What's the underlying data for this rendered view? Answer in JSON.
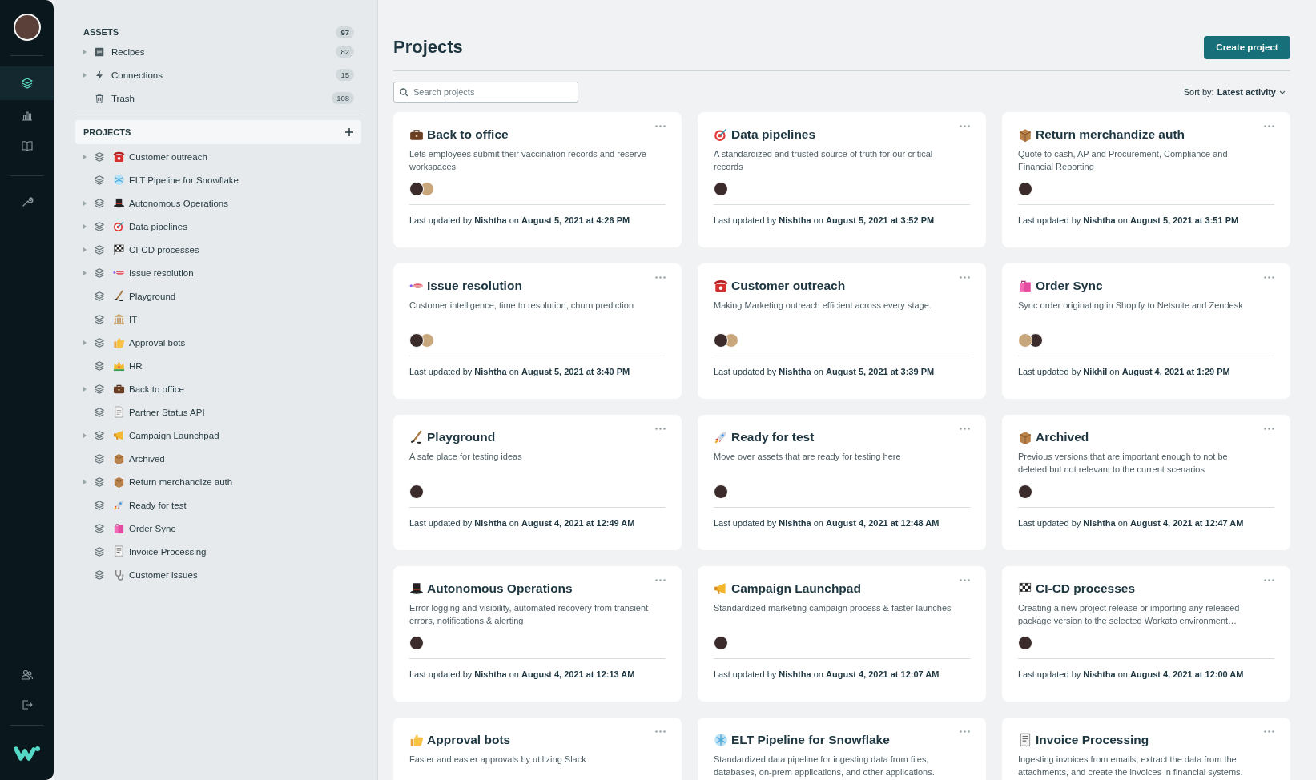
{
  "rail": {
    "top": [
      {
        "kind": "layers",
        "selected": true
      },
      {
        "kind": "chart",
        "selected": false
      },
      {
        "kind": "book",
        "selected": false
      }
    ],
    "tools": [
      {
        "kind": "wrench",
        "selected": false
      }
    ],
    "bottom": [
      {
        "kind": "users",
        "selected": false
      },
      {
        "kind": "logout",
        "selected": false
      }
    ]
  },
  "sidebar": {
    "assets": {
      "title": "ASSETS",
      "count": "97",
      "items": [
        {
          "kind": "recipe",
          "label": "Recipes",
          "count": "82",
          "expandable": true
        },
        {
          "kind": "bolt",
          "label": "Connections",
          "count": "15",
          "expandable": true
        },
        {
          "kind": "trash",
          "label": "Trash",
          "count": "108",
          "expandable": false
        }
      ]
    },
    "projects": {
      "title": "PROJECTS",
      "items": [
        {
          "kind": "telephone",
          "label": "Customer outreach",
          "expandable": true
        },
        {
          "kind": "snowflake",
          "label": "ELT Pipeline for Snowflake",
          "expandable": false
        },
        {
          "kind": "tophat",
          "label": "Autonomous Operations",
          "expandable": true
        },
        {
          "kind": "target",
          "label": "Data pipelines",
          "expandable": true
        },
        {
          "kind": "flag",
          "label": "CI-CD processes",
          "expandable": true
        },
        {
          "kind": "lips",
          "label": "Issue resolution",
          "expandable": true
        },
        {
          "kind": "hockey",
          "label": "Playground",
          "expandable": false
        },
        {
          "kind": "building",
          "label": "IT",
          "expandable": false
        },
        {
          "kind": "thumbs",
          "label": "Approval bots",
          "expandable": true
        },
        {
          "kind": "crown",
          "label": "HR",
          "expandable": false
        },
        {
          "kind": "briefcase",
          "label": "Back to office",
          "expandable": true
        },
        {
          "kind": "document",
          "label": "Partner Status API",
          "expandable": false
        },
        {
          "kind": "megaphone",
          "label": "Campaign Launchpad",
          "expandable": true
        },
        {
          "kind": "package",
          "label": "Archived",
          "expandable": false
        },
        {
          "kind": "package",
          "label": "Return merchandize auth",
          "expandable": true
        },
        {
          "kind": "rocket",
          "label": "Ready for test",
          "expandable": false
        },
        {
          "kind": "bags",
          "label": "Order Sync",
          "expandable": false
        },
        {
          "kind": "receipt",
          "label": "Invoice Processing",
          "expandable": false
        },
        {
          "kind": "stethoscope",
          "label": "Customer issues",
          "expandable": false
        }
      ]
    }
  },
  "main": {
    "title": "Projects",
    "create_button": "Create project",
    "search": {
      "placeholder": "Search projects"
    },
    "sort": {
      "label": "Sort by:",
      "value": "Latest activity"
    },
    "cards": [
      {
        "kind": "briefcase",
        "title": "Back to office",
        "description": "Lets employees submit their vaccination records and reserve workspaces",
        "avatars": [
          {
            "kind": "dark"
          },
          {
            "kind": "light"
          }
        ],
        "updated": "Last updated by **Nishtha** on **August 5, 2021 at 4:26 PM**"
      },
      {
        "kind": "target",
        "title": "Data pipelines",
        "description": "A standardized and trusted source of truth for our critical records",
        "avatars": [
          {
            "kind": "dark"
          }
        ],
        "updated": "Last updated by **Nishtha** on **August 5, 2021 at 3:52 PM**"
      },
      {
        "kind": "package",
        "title": "Return merchandize auth",
        "description": "Quote to cash, AP and Procurement, Compliance and Financial Reporting",
        "avatars": [
          {
            "kind": "dark"
          }
        ],
        "updated": "Last updated by **Nishtha** on **August 5, 2021 at 3:51 PM**"
      },
      {
        "kind": "lips",
        "title": "Issue resolution",
        "description": "Customer intelligence, time to resolution, churn prediction",
        "avatars": [
          {
            "kind": "dark"
          },
          {
            "kind": "light"
          }
        ],
        "updated": "Last updated by **Nishtha** on **August 5, 2021 at 3:40 PM**"
      },
      {
        "kind": "telephone",
        "title": "Customer outreach",
        "description": "Making Marketing outreach efficient across every stage.",
        "avatars": [
          {
            "kind": "dark"
          },
          {
            "kind": "light"
          }
        ],
        "updated": "Last updated by **Nishtha** on **August 5, 2021 at 3:39 PM**"
      },
      {
        "kind": "bags",
        "title": "Order Sync",
        "description": "Sync order originating in Shopify to Netsuite and Zendesk",
        "avatars": [
          {
            "kind": "light"
          },
          {
            "kind": "dark"
          }
        ],
        "updated": "Last updated by **Nikhil** on **August 4, 2021 at 1:29 PM**"
      },
      {
        "kind": "hockey",
        "title": "Playground",
        "description": "A safe place for testing ideas",
        "avatars": [
          {
            "kind": "dark"
          }
        ],
        "updated": "Last updated by **Nishtha** on **August 4, 2021 at 12:49 AM**"
      },
      {
        "kind": "rocket",
        "title": "Ready for test",
        "description": "Move over assets that are ready for testing here",
        "avatars": [
          {
            "kind": "dark"
          }
        ],
        "updated": "Last updated by **Nishtha** on **August 4, 2021 at 12:48 AM**"
      },
      {
        "kind": "package",
        "title": "Archived",
        "description": "Previous versions that are important enough to not be deleted but not relevant to the current scenarios",
        "avatars": [
          {
            "kind": "dark"
          }
        ],
        "updated": "Last updated by **Nishtha** on **August 4, 2021 at 12:47 AM**"
      },
      {
        "kind": "tophat",
        "title": "Autonomous Operations",
        "description": "Error logging and visibility, automated recovery from transient errors, notifications & alerting",
        "avatars": [
          {
            "kind": "dark"
          }
        ],
        "updated": "Last updated by **Nishtha** on **August 4, 2021 at 12:13 AM**"
      },
      {
        "kind": "megaphone",
        "title": "Campaign Launchpad",
        "description": "Standardized marketing campaign process & faster launches",
        "avatars": [
          {
            "kind": "dark"
          }
        ],
        "updated": "Last updated by **Nishtha** on **August 4, 2021 at 12:07 AM**"
      },
      {
        "kind": "flag",
        "title": "CI-CD processes",
        "description": "Creating a new project release or importing any released package version to the selected Workato environment…",
        "avatars": [
          {
            "kind": "dark"
          }
        ],
        "updated": "Last updated by **Nishtha** on **August 4, 2021 at 12:00 AM**"
      },
      {
        "kind": "thumbs",
        "title": "Approval bots",
        "description": "Faster and easier approvals by utilizing Slack"
      },
      {
        "kind": "snowflake",
        "title": "ELT Pipeline for Snowflake",
        "description": "Standardized data pipeline for ingesting data from files, databases, on-prem applications, and other applications."
      },
      {
        "kind": "receipt",
        "title": "Invoice Processing",
        "description": "Ingesting invoices from emails, extract the data from the attachments, and create the invoices in financial systems."
      }
    ]
  }
}
